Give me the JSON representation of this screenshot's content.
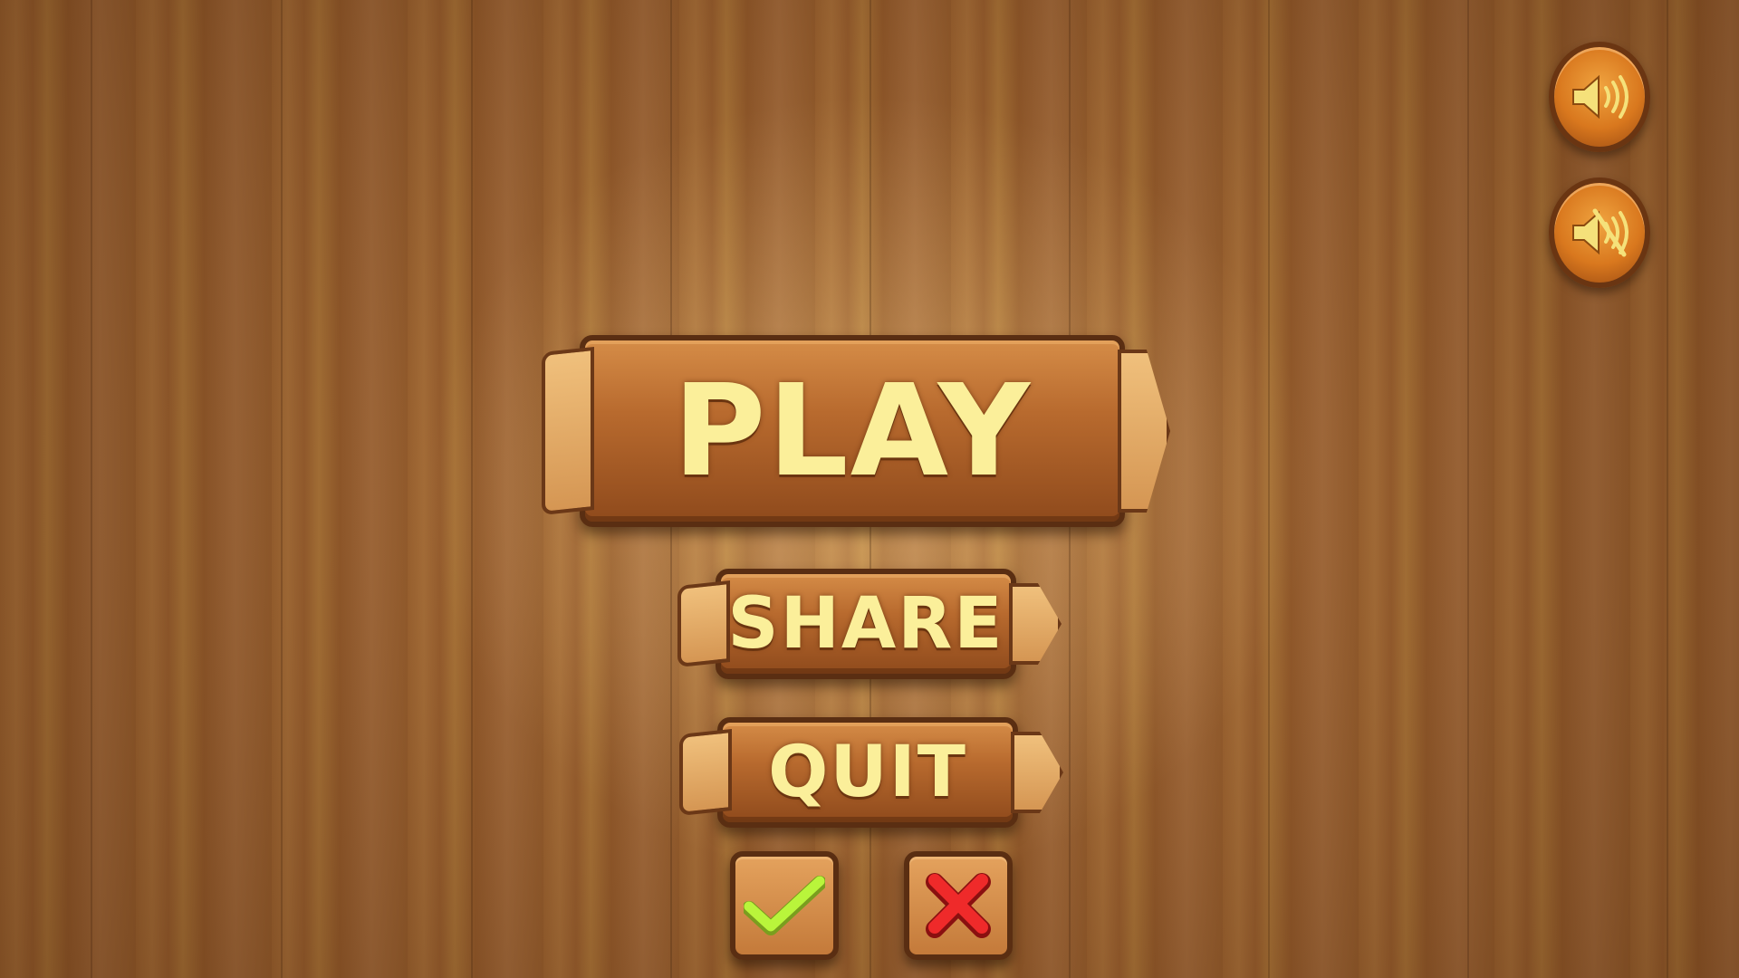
{
  "menu": {
    "play_label": "PLAY",
    "share_label": "SHARE",
    "quit_label": "QUIT"
  },
  "icons": {
    "confirm": "checkmark-icon",
    "cancel": "x-icon",
    "sound_on": "speaker-icon",
    "sound_off": "speaker-muted-icon"
  },
  "colors": {
    "label_text": "#fbef9a",
    "checkmark": "#b9f53b",
    "cross": "#ef2a2a",
    "speaker": "#f5e17a"
  }
}
